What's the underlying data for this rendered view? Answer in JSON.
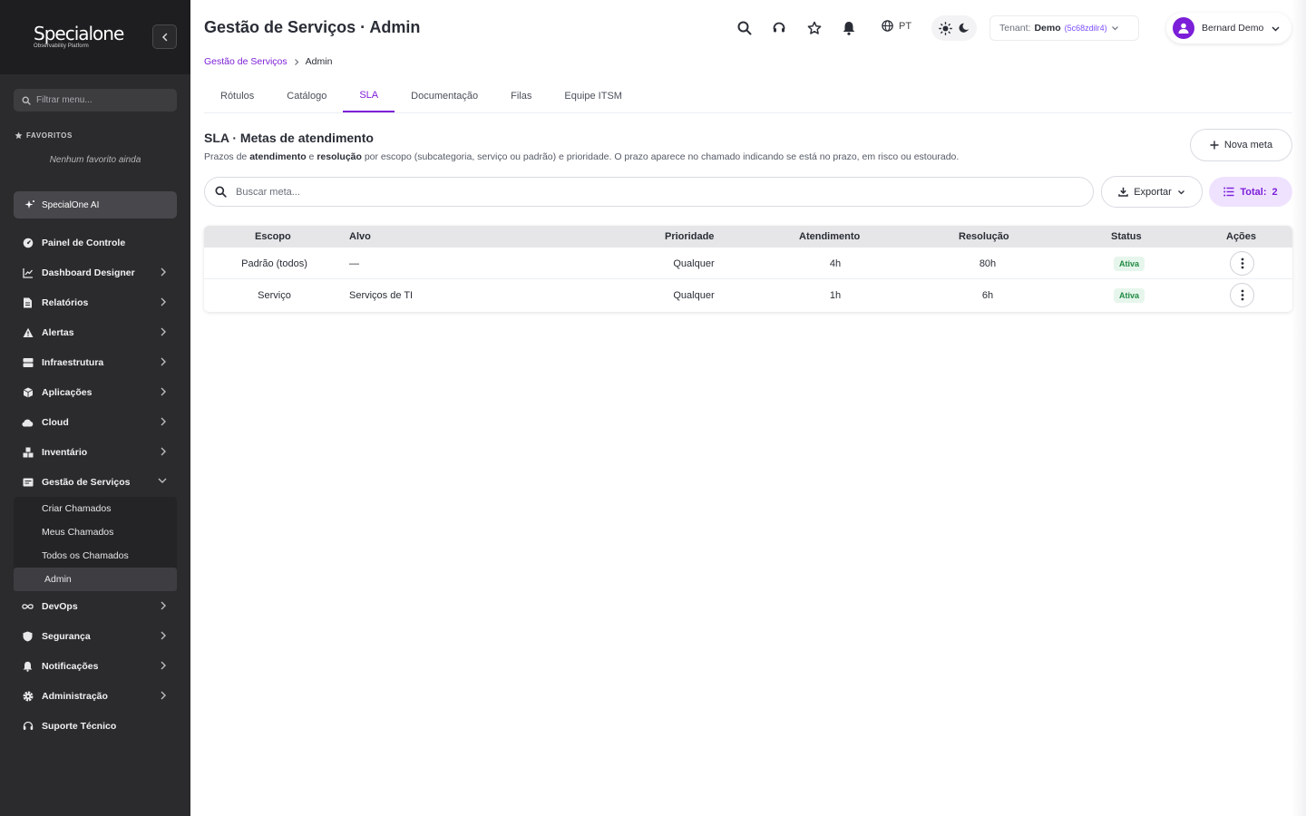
{
  "brand": {
    "name": "Specialone",
    "tagline": "Observability Platform"
  },
  "sidebar": {
    "filter_placeholder": "Filtrar menu...",
    "favorites_heading": "FAVORITOS",
    "favorites_empty": "Nenhum favorito ainda",
    "ai_label": "SpecialOne AI",
    "items": [
      {
        "label": "Painel de Controle"
      },
      {
        "label": "Dashboard Designer"
      },
      {
        "label": "Relatórios"
      },
      {
        "label": "Alertas"
      },
      {
        "label": "Infraestrutura"
      },
      {
        "label": "Aplicações"
      },
      {
        "label": "Cloud"
      },
      {
        "label": "Inventário"
      },
      {
        "label": "Gestão de Serviços"
      },
      {
        "label": "DevOps"
      },
      {
        "label": "Segurança"
      },
      {
        "label": "Notificações"
      },
      {
        "label": "Administração"
      },
      {
        "label": "Suporte Técnico"
      }
    ],
    "subitems": [
      {
        "label": "Criar Chamados"
      },
      {
        "label": "Meus Chamados"
      },
      {
        "label": "Todos os Chamados"
      },
      {
        "label": "Admin"
      }
    ]
  },
  "header": {
    "title": "Gestão de Serviços · Admin",
    "language": "PT",
    "tenant_label": "Tenant:",
    "tenant_name": "Demo",
    "tenant_id": "(5c68zdilr4)",
    "user_name": "Bernard Demo"
  },
  "breadcrumb": {
    "parent": "Gestão de Serviços",
    "current": "Admin"
  },
  "tabs": [
    {
      "label": "Rótulos"
    },
    {
      "label": "Catálogo"
    },
    {
      "label": "SLA"
    },
    {
      "label": "Documentação"
    },
    {
      "label": "Filas"
    },
    {
      "label": "Equipe ITSM"
    }
  ],
  "section": {
    "title": "SLA · Metas de atendimento",
    "desc_1": "Prazos de ",
    "desc_b1": "atendimento",
    "desc_2": " e ",
    "desc_b2": "resolução",
    "desc_3": " por escopo (subcategoria, serviço ou padrão) e prioridade. O prazo aparece no chamado indicando se está no prazo, em risco ou estourado.",
    "new_button": "Nova meta"
  },
  "toolbar": {
    "search_placeholder": "Buscar meta...",
    "export_label": "Exportar",
    "total_label": "Total:",
    "total_value": "2"
  },
  "table": {
    "columns": {
      "escopo": "Escopo",
      "alvo": "Alvo",
      "prioridade": "Prioridade",
      "atendimento": "Atendimento",
      "resolucao": "Resolução",
      "status": "Status",
      "acoes": "Ações"
    },
    "rows": [
      {
        "escopo": "Padrão (todos)",
        "alvo": "—",
        "prioridade": "Qualquer",
        "atendimento": "4h",
        "resolucao": "80h",
        "status": "Ativa"
      },
      {
        "escopo": "Serviço",
        "alvo": "Serviços de TI",
        "prioridade": "Qualquer",
        "atendimento": "1h",
        "resolucao": "6h",
        "status": "Ativa"
      }
    ]
  },
  "colors": {
    "accent": "#7c1fd8",
    "sidebar_bg": "#2b2b2d",
    "status_ok": "#1f8a43"
  }
}
